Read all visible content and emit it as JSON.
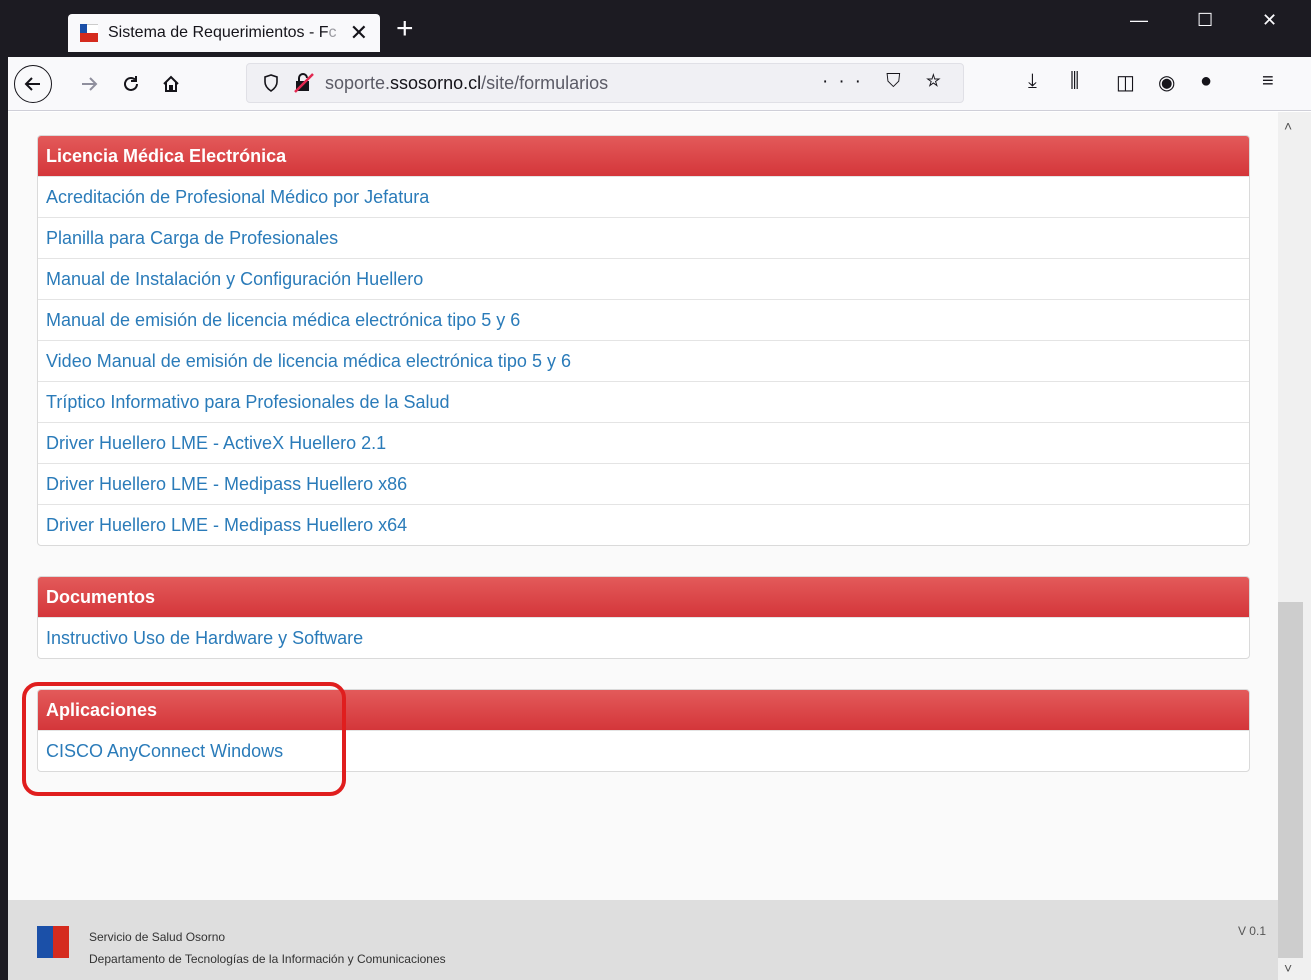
{
  "browser": {
    "tab_title": "Sistema de Requerimientos - F",
    "tab_title_fade": "c",
    "new_tab": "+",
    "close_tab": "✕",
    "minimize": "—",
    "maximize": "☐",
    "close_window": "✕",
    "url_prefix": "soporte.",
    "url_host": "ssosorno.cl",
    "url_path": "/site/formularios",
    "url_actions": "··· ⛉ ☆"
  },
  "panels": [
    {
      "title": "Licencia Médica Electrónica",
      "items": [
        "Acreditación de Profesional Médico por Jefatura",
        "Planilla para Carga de Profesionales",
        "Manual de Instalación y Configuración Huellero",
        "Manual de emisión de licencia médica electrónica tipo 5 y 6",
        "Video Manual de emisión de licencia médica electrónica tipo 5 y 6",
        "Tríptico Informativo para Profesionales de la Salud",
        "Driver Huellero LME - ActiveX Huellero 2.1",
        "Driver Huellero LME - Medipass Huellero x86",
        "Driver Huellero LME - Medipass Huellero x64"
      ]
    },
    {
      "title": "Documentos",
      "items": [
        "Instructivo Uso de Hardware y Software"
      ]
    },
    {
      "title": "Aplicaciones",
      "items": [
        "CISCO AnyConnect Windows"
      ]
    }
  ],
  "footer": {
    "line1": "Servicio de Salud Osorno",
    "line2": "Departamento de Tecnologías de la Información y Comunicaciones",
    "version": "V 0.1"
  },
  "colors": {
    "panel_header": "#d4363a",
    "link": "#2a7bb9",
    "highlight": "#e01e1e"
  }
}
